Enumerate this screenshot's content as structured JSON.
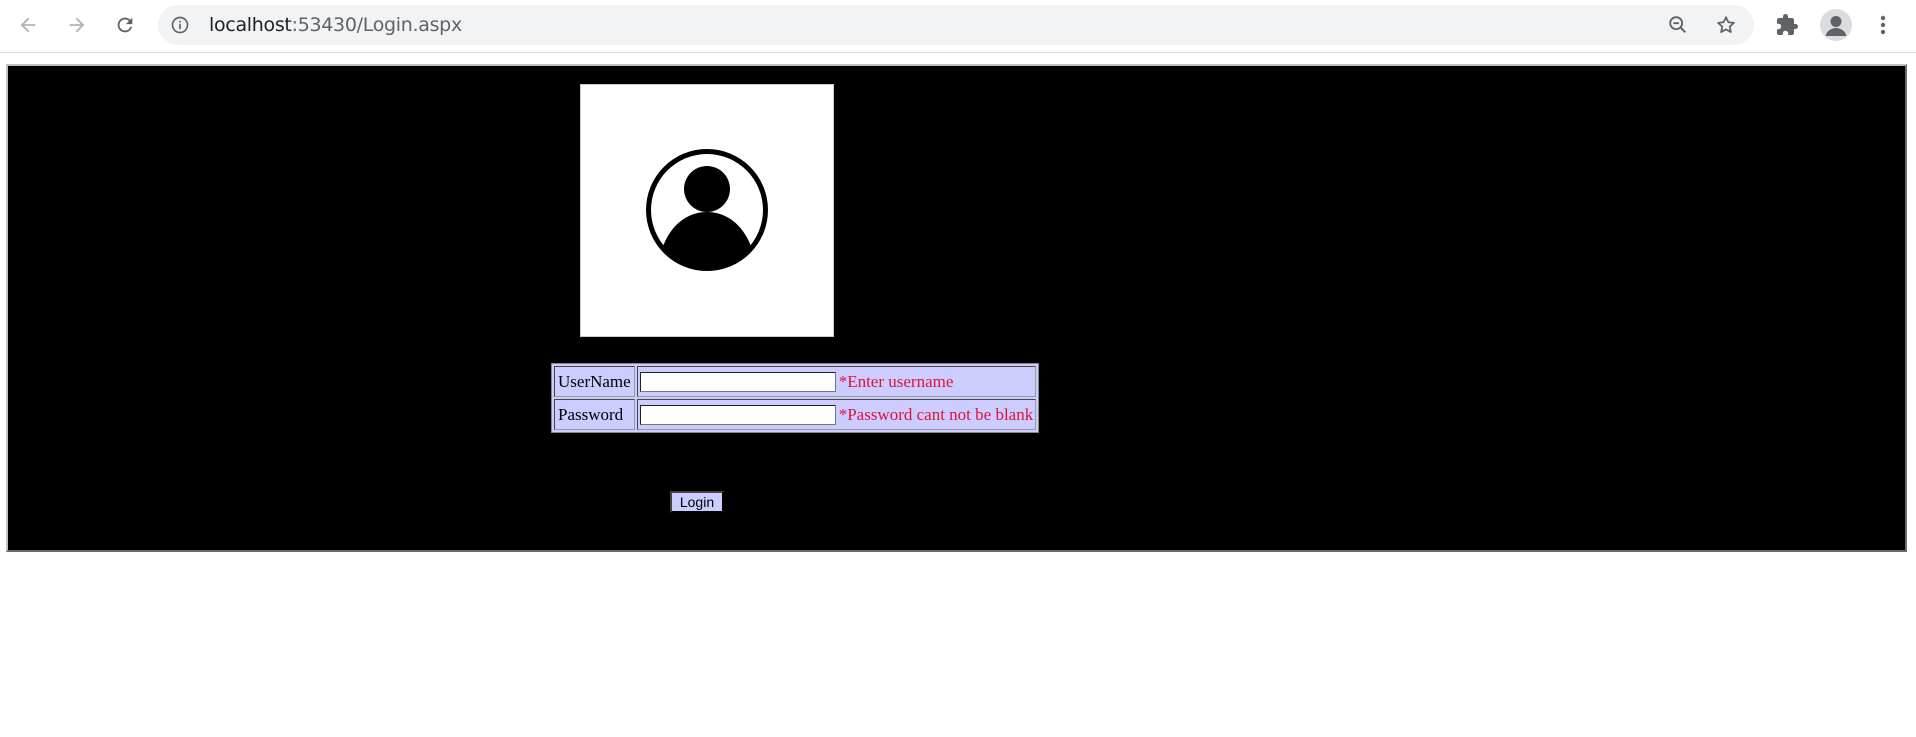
{
  "browser": {
    "url_host": "localhost",
    "url_path": ":53430/Login.aspx",
    "back_icon": "arrow-left-icon",
    "forward_icon": "arrow-right-icon",
    "reload_icon": "reload-icon",
    "info_icon": "info-icon",
    "zoom_icon": "zoom-out-icon",
    "bookmark_icon": "star-icon",
    "extensions_icon": "puzzle-icon",
    "menu_icon": "kebab-menu-icon"
  },
  "login": {
    "username_label": "UserName",
    "password_label": "Password",
    "username_value": "",
    "password_value": "",
    "username_error": "*Enter username",
    "password_error": "*Password cant not be blank",
    "submit_label": "Login"
  },
  "colors": {
    "panel_background": "#000000",
    "form_background": "#ccccff",
    "validator_color": "#dc143c"
  }
}
